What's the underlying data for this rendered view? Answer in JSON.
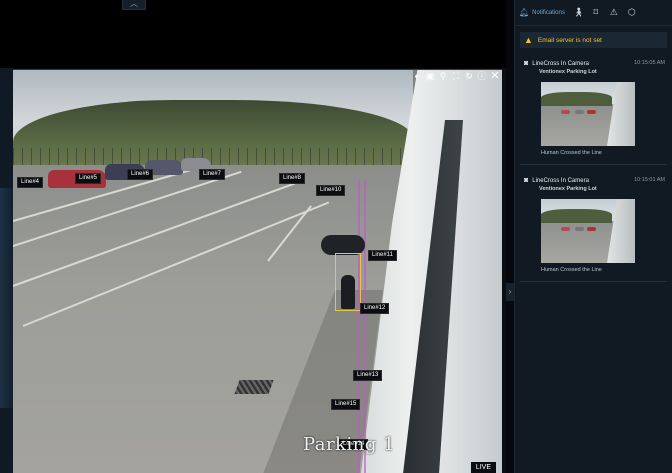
{
  "viewer": {
    "camera_name_overlay": "Parking 1",
    "live_badge": "LIVE",
    "line_labels": [
      {
        "id": "line4",
        "label": "Line#4"
      },
      {
        "id": "line5",
        "label": "Line#5"
      },
      {
        "id": "line6",
        "label": "Line#6"
      },
      {
        "id": "line7",
        "label": "Line#7"
      },
      {
        "id": "line8",
        "label": "Line#8"
      },
      {
        "id": "line10",
        "label": "Line#10"
      },
      {
        "id": "line11",
        "label": "Line#11"
      },
      {
        "id": "line12",
        "label": "Line#12"
      },
      {
        "id": "line13",
        "label": "Line#13"
      },
      {
        "id": "line15",
        "label": "Line#15"
      },
      {
        "id": "line14",
        "label": "Line#14"
      }
    ],
    "toolbar_icons": [
      "contrast-icon",
      "image-icon",
      "person-detect-icon",
      "fullscreen-icon",
      "refresh-icon",
      "info-icon",
      "close-icon"
    ]
  },
  "panel": {
    "notifications_tab": "Notifications",
    "header_icons": [
      "bell-icon",
      "walking-person-icon",
      "bookmark-icon",
      "warning-icon",
      "stop-icon"
    ],
    "alert": {
      "text": "Email server is not set",
      "color": "#f2c230"
    },
    "cards": [
      {
        "title": "LineCross In Camera",
        "time": "10:15:05 AM",
        "location": "Ventionex Parking Lot",
        "event": "Human Crossed the Line"
      },
      {
        "title": "LineCross In Camera",
        "time": "10:15:01 AM",
        "location": "Ventionex Parking Lot",
        "event": "Human Crossed the Line"
      }
    ]
  },
  "colors": {
    "accent": "#6ea9d6",
    "panel_bg": "#111a22",
    "warning": "#f2c230",
    "detection_box": "#e6c64a"
  }
}
